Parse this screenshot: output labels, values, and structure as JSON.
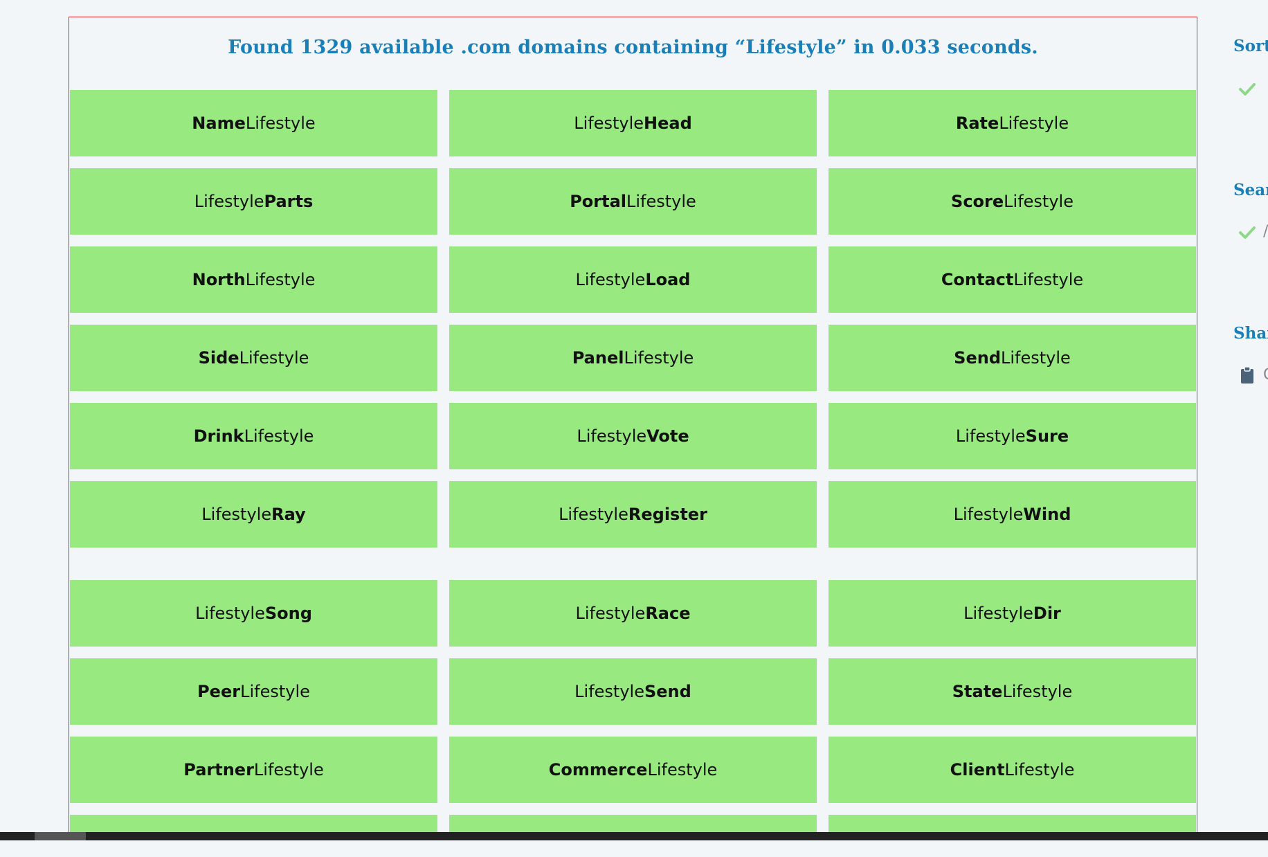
{
  "results": {
    "title": "Found 1329 available .com domains containing “Lifestyle” in 0.033 seconds.",
    "keyword": "Lifestyle",
    "rows": [
      [
        {
          "parts": [
            {
              "text": "Name",
              "bold": true
            },
            {
              "text": "Lifestyle",
              "bold": false
            }
          ]
        },
        {
          "parts": [
            {
              "text": "Lifestyle",
              "bold": false
            },
            {
              "text": "Head",
              "bold": true
            }
          ]
        },
        {
          "parts": [
            {
              "text": "Rate",
              "bold": true
            },
            {
              "text": "Lifestyle",
              "bold": false
            }
          ]
        }
      ],
      [
        {
          "parts": [
            {
              "text": "Lifestyle",
              "bold": false
            },
            {
              "text": "Parts",
              "bold": true
            }
          ]
        },
        {
          "parts": [
            {
              "text": "Portal",
              "bold": true
            },
            {
              "text": "Lifestyle",
              "bold": false
            }
          ]
        },
        {
          "parts": [
            {
              "text": "Score",
              "bold": true
            },
            {
              "text": "Lifestyle",
              "bold": false
            }
          ]
        }
      ],
      [
        {
          "parts": [
            {
              "text": "North",
              "bold": true
            },
            {
              "text": "Lifestyle",
              "bold": false
            }
          ]
        },
        {
          "parts": [
            {
              "text": "Lifestyle",
              "bold": false
            },
            {
              "text": "Load",
              "bold": true
            }
          ]
        },
        {
          "parts": [
            {
              "text": "Contact",
              "bold": true
            },
            {
              "text": "Lifestyle",
              "bold": false
            }
          ]
        }
      ],
      [
        {
          "parts": [
            {
              "text": "Side",
              "bold": true
            },
            {
              "text": "Lifestyle",
              "bold": false
            }
          ]
        },
        {
          "parts": [
            {
              "text": "Panel",
              "bold": true
            },
            {
              "text": "Lifestyle",
              "bold": false
            }
          ]
        },
        {
          "parts": [
            {
              "text": "Send",
              "bold": true
            },
            {
              "text": "Lifestyle",
              "bold": false
            }
          ]
        }
      ],
      [
        {
          "parts": [
            {
              "text": "Drink",
              "bold": true
            },
            {
              "text": "Lifestyle",
              "bold": false
            }
          ]
        },
        {
          "parts": [
            {
              "text": "Lifestyle",
              "bold": false
            },
            {
              "text": "Vote",
              "bold": true
            }
          ]
        },
        {
          "parts": [
            {
              "text": "Lifestyle",
              "bold": false
            },
            {
              "text": "Sure",
              "bold": true
            }
          ]
        }
      ],
      [
        {
          "parts": [
            {
              "text": "Lifestyle",
              "bold": false
            },
            {
              "text": "Ray",
              "bold": true
            }
          ]
        },
        {
          "parts": [
            {
              "text": "Lifestyle",
              "bold": false
            },
            {
              "text": "Register",
              "bold": true
            }
          ]
        },
        {
          "parts": [
            {
              "text": "Lifestyle",
              "bold": false
            },
            {
              "text": "Wind",
              "bold": true
            }
          ]
        }
      ],
      [
        {
          "parts": [
            {
              "text": "Lifestyle",
              "bold": false
            },
            {
              "text": "Song",
              "bold": true
            }
          ]
        },
        {
          "parts": [
            {
              "text": "Lifestyle",
              "bold": false
            },
            {
              "text": "Race",
              "bold": true
            }
          ]
        },
        {
          "parts": [
            {
              "text": "Lifestyle",
              "bold": false
            },
            {
              "text": "Dir",
              "bold": true
            }
          ]
        }
      ],
      [
        {
          "parts": [
            {
              "text": "Peer",
              "bold": true
            },
            {
              "text": "Lifestyle",
              "bold": false
            }
          ]
        },
        {
          "parts": [
            {
              "text": "Lifestyle",
              "bold": false
            },
            {
              "text": "Send",
              "bold": true
            }
          ]
        },
        {
          "parts": [
            {
              "text": "State",
              "bold": true
            },
            {
              "text": "Lifestyle",
              "bold": false
            }
          ]
        }
      ],
      [
        {
          "parts": [
            {
              "text": "Partner",
              "bold": true
            },
            {
              "text": "Lifestyle",
              "bold": false
            }
          ]
        },
        {
          "parts": [
            {
              "text": "Commerce",
              "bold": true
            },
            {
              "text": "Lifestyle",
              "bold": false
            }
          ]
        },
        {
          "parts": [
            {
              "text": "Client",
              "bold": true
            },
            {
              "text": "Lifestyle",
              "bold": false
            }
          ]
        }
      ],
      [
        {
          "parts": []
        },
        {
          "parts": []
        },
        {
          "parts": []
        }
      ]
    ]
  },
  "sidebar": {
    "sort_heading": "Sort",
    "search_heading": "Searc",
    "search_extra": "/",
    "share_heading": "Shar",
    "share_extra": "C"
  },
  "colors": {
    "accent": "#1b7fb7",
    "tile": "#98e980",
    "border": "#e8232a",
    "check": "#8fd88a",
    "clipboard": "#4a6378"
  },
  "icons": [
    "checkmark-icon",
    "clipboard-icon"
  ]
}
